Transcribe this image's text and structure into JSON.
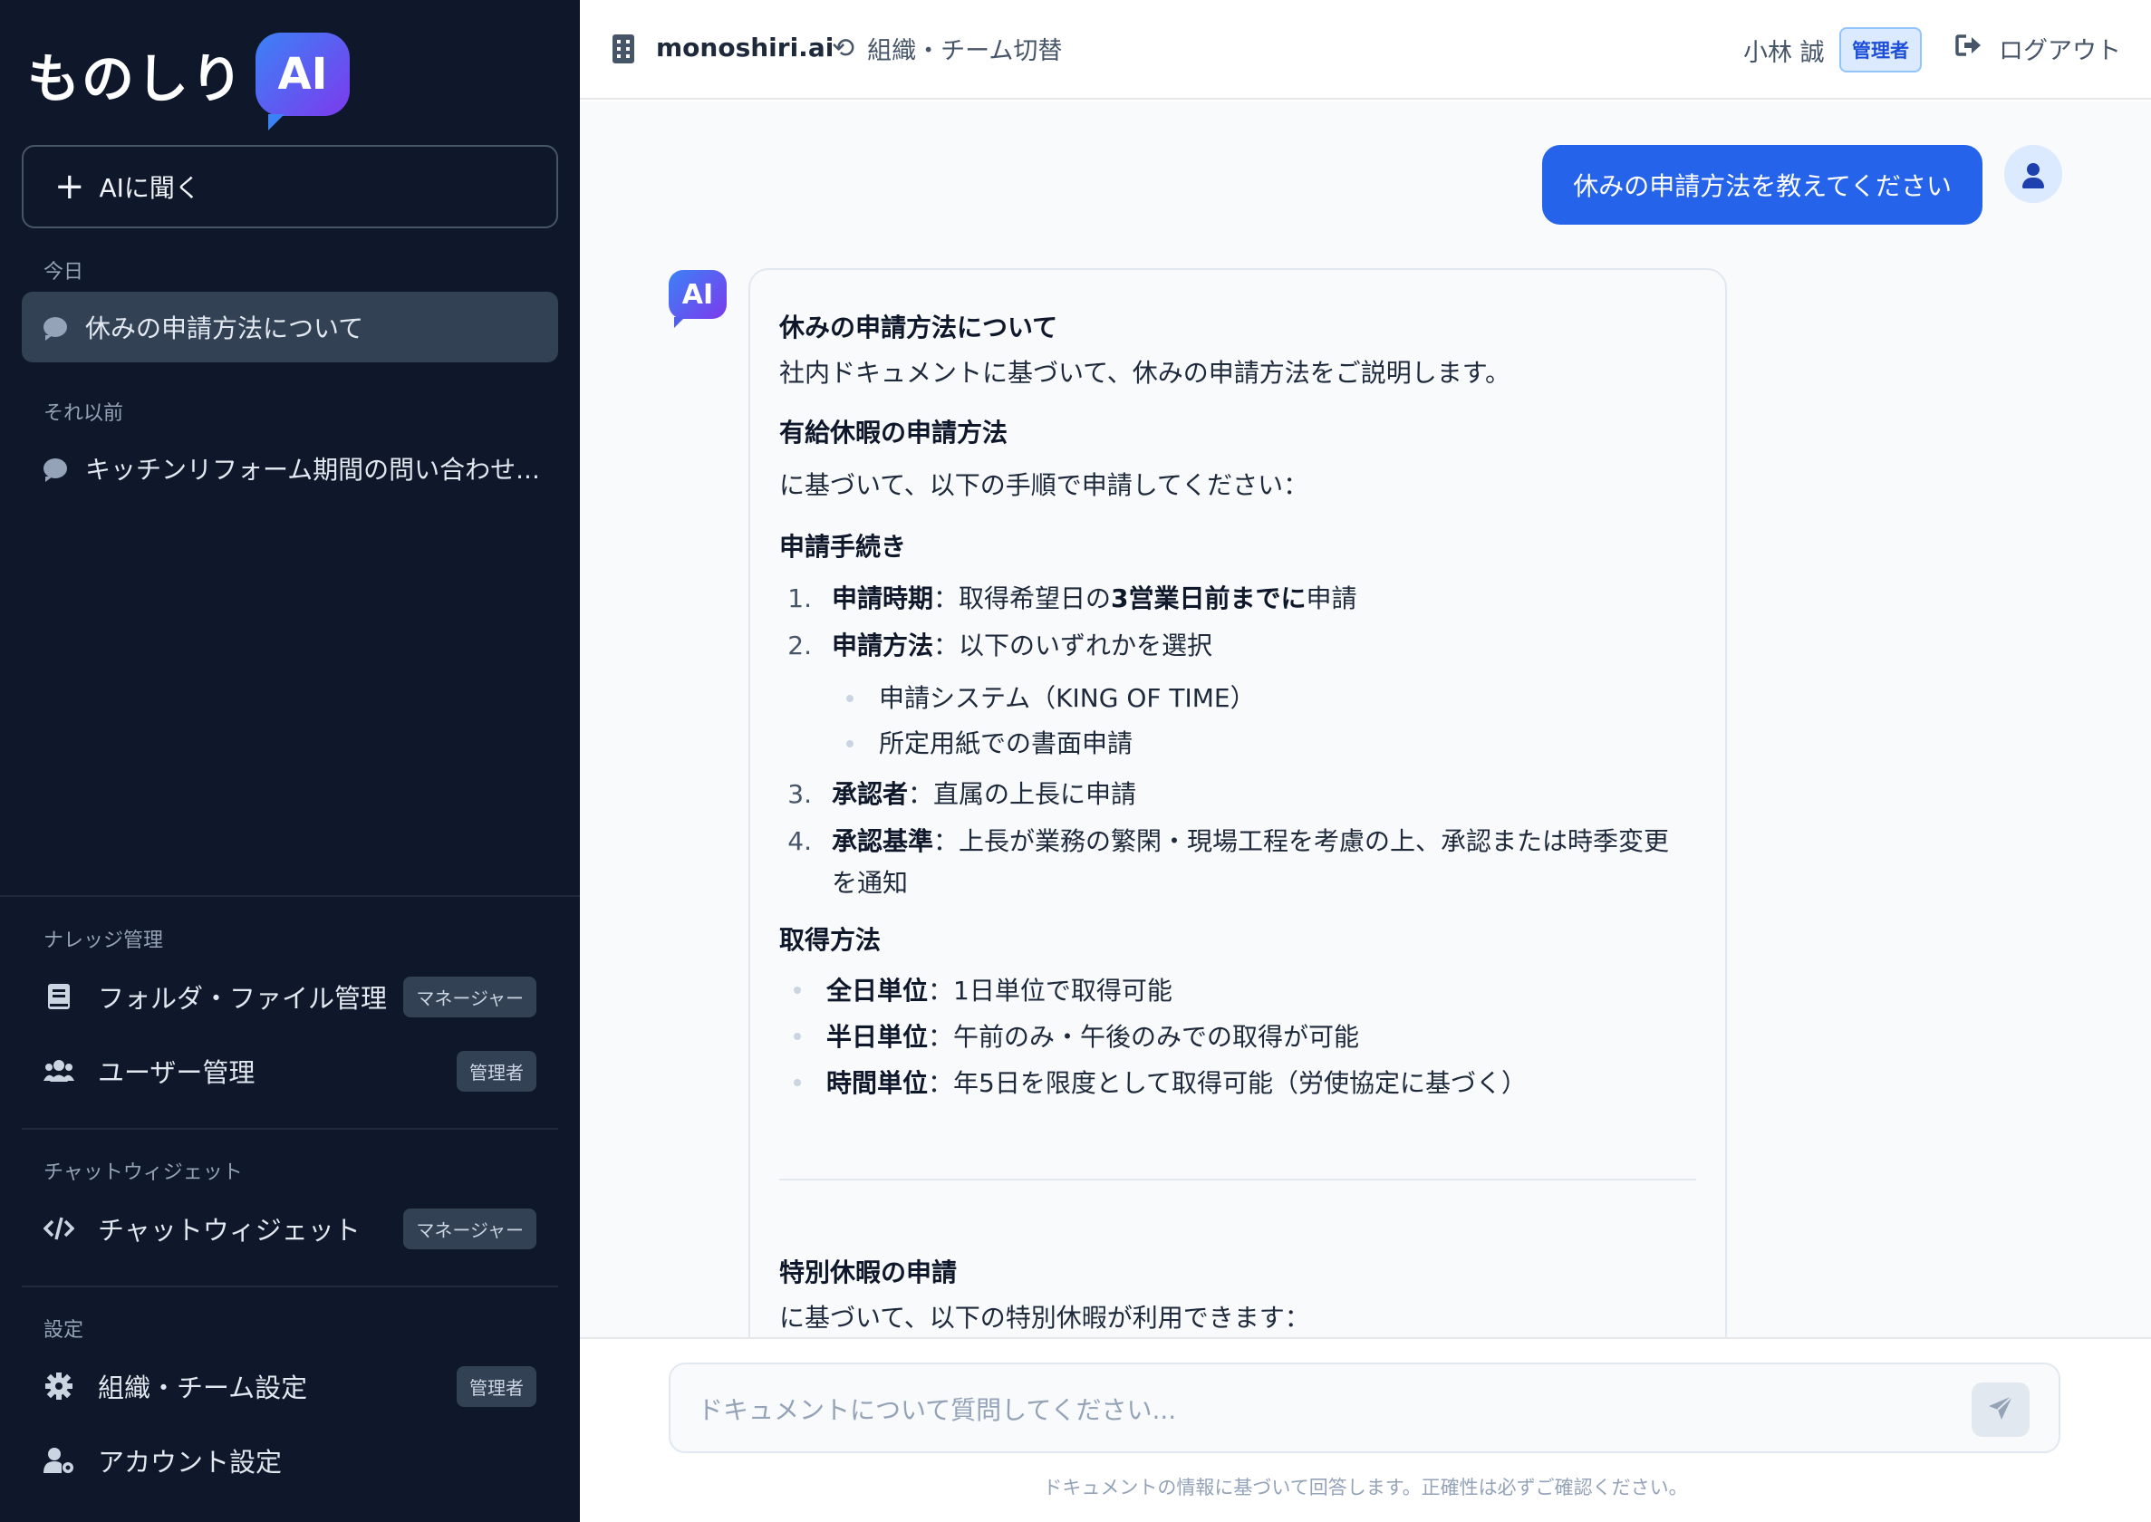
{
  "app": {
    "logo_text": "ものしり",
    "logo_badge": "AI"
  },
  "sidebar": {
    "new_chat_label": "AIに聞く",
    "history_sections": [
      {
        "label": "今日",
        "items": [
          {
            "title": "休みの申請方法について",
            "active": true
          }
        ]
      },
      {
        "label": "それ以前",
        "items": [
          {
            "title": "キッチンリフォーム期間の問い合わせ...",
            "active": false
          }
        ]
      }
    ],
    "nav_sections": [
      {
        "label": "ナレッジ管理",
        "items": [
          {
            "label": "フォルダ・ファイル管理",
            "icon": "book-icon",
            "role": "マネージャー"
          },
          {
            "label": "ユーザー管理",
            "icon": "users-icon",
            "role": "管理者"
          }
        ]
      },
      {
        "label": "チャットウィジェット",
        "items": [
          {
            "label": "チャットウィジェット",
            "icon": "code-icon",
            "role": "マネージャー"
          }
        ]
      },
      {
        "label": "設定",
        "items": [
          {
            "label": "組織・チーム設定",
            "icon": "gear-icon",
            "role": "管理者"
          },
          {
            "label": "アカウント設定",
            "icon": "user-gear-icon",
            "role": ""
          }
        ]
      }
    ]
  },
  "topbar": {
    "org_name": "monoshiri.ai",
    "switch_label": "組織・チーム切替",
    "user_name": "小林 誠",
    "user_role": "管理者",
    "logout_label": "ログアウト"
  },
  "chat": {
    "user_message": "休みの申請方法を教えてください",
    "ai_badge": "AI",
    "answer": {
      "title": "休みの申請方法について",
      "intro": "社内ドキュメントに基づいて、休みの申請方法をご説明します。",
      "section1_heading": "有給休暇の申請方法",
      "section1_text": "に基づいて、以下の手順で申請してください：",
      "procedure_heading": "申請手続き",
      "steps": [
        {
          "num": "1.",
          "term": "申請時期",
          "text_a": "：取得希望日の",
          "text_b": "3営業日前までに",
          "text_c": "申請"
        },
        {
          "num": "2.",
          "term": "申請方法",
          "text_a": "：以下のいずれかを選択"
        },
        {
          "num": "3.",
          "term": "承認者",
          "text_a": "：直属の上長に申請"
        },
        {
          "num": "4.",
          "term": "承認基準",
          "text_a": "：上長が業務の繁閑・現場工程を考慮の上、承認または時季変更を通知"
        }
      ],
      "methods": [
        "申請システム（KING OF TIME）",
        "所定用紙での書面申請"
      ],
      "acquisition_heading": "取得方法",
      "units": [
        {
          "term": "全日単位",
          "text": "：1日単位で取得可能"
        },
        {
          "term": "半日単位",
          "text": "：午前のみ・午後のみでの取得が可能"
        },
        {
          "term": "時間単位",
          "text": "：年5日を限度として取得可能（労使協定に基づく）"
        }
      ],
      "special_heading": "特別休暇の申請",
      "special_text": "に基づいて、以下の特別休暇が利用できます："
    }
  },
  "composer": {
    "placeholder": "ドキュメントについて質問してください...",
    "disclaimer": "ドキュメントの情報に基づいて回答します。正確性は必ずご確認ください。"
  }
}
